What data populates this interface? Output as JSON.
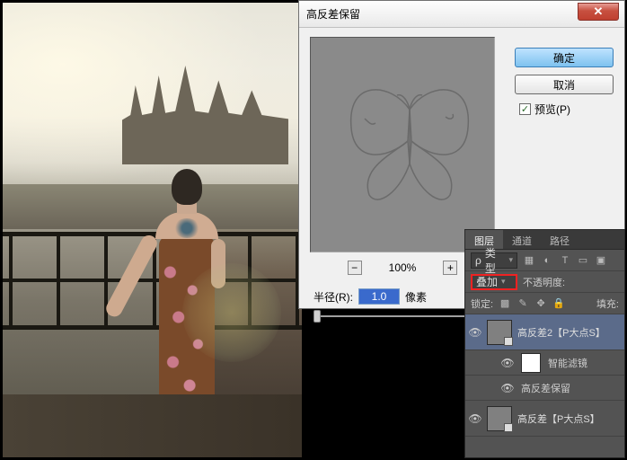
{
  "dialog": {
    "title": "高反差保留",
    "ok": "确定",
    "cancel": "取消",
    "preview_label": "预览(P)",
    "preview_checked": true,
    "zoom": "100%",
    "radius_label": "半径(R):",
    "radius_value": "1.0",
    "radius_unit": "像素"
  },
  "layers_panel": {
    "tabs": {
      "layers": "图层",
      "channels": "通道",
      "paths": "路径"
    },
    "filter_label": "类型",
    "blend_mode": "叠加",
    "opacity_label": "不透明度:",
    "lock_label": "锁定:",
    "fill_label": "填充:",
    "items": [
      {
        "name": "高反差2【P大点S】",
        "smart_filter_label": "智能滤镜",
        "filter_name": "高反差保留"
      },
      {
        "name": "高反差【P大点S】"
      }
    ]
  }
}
